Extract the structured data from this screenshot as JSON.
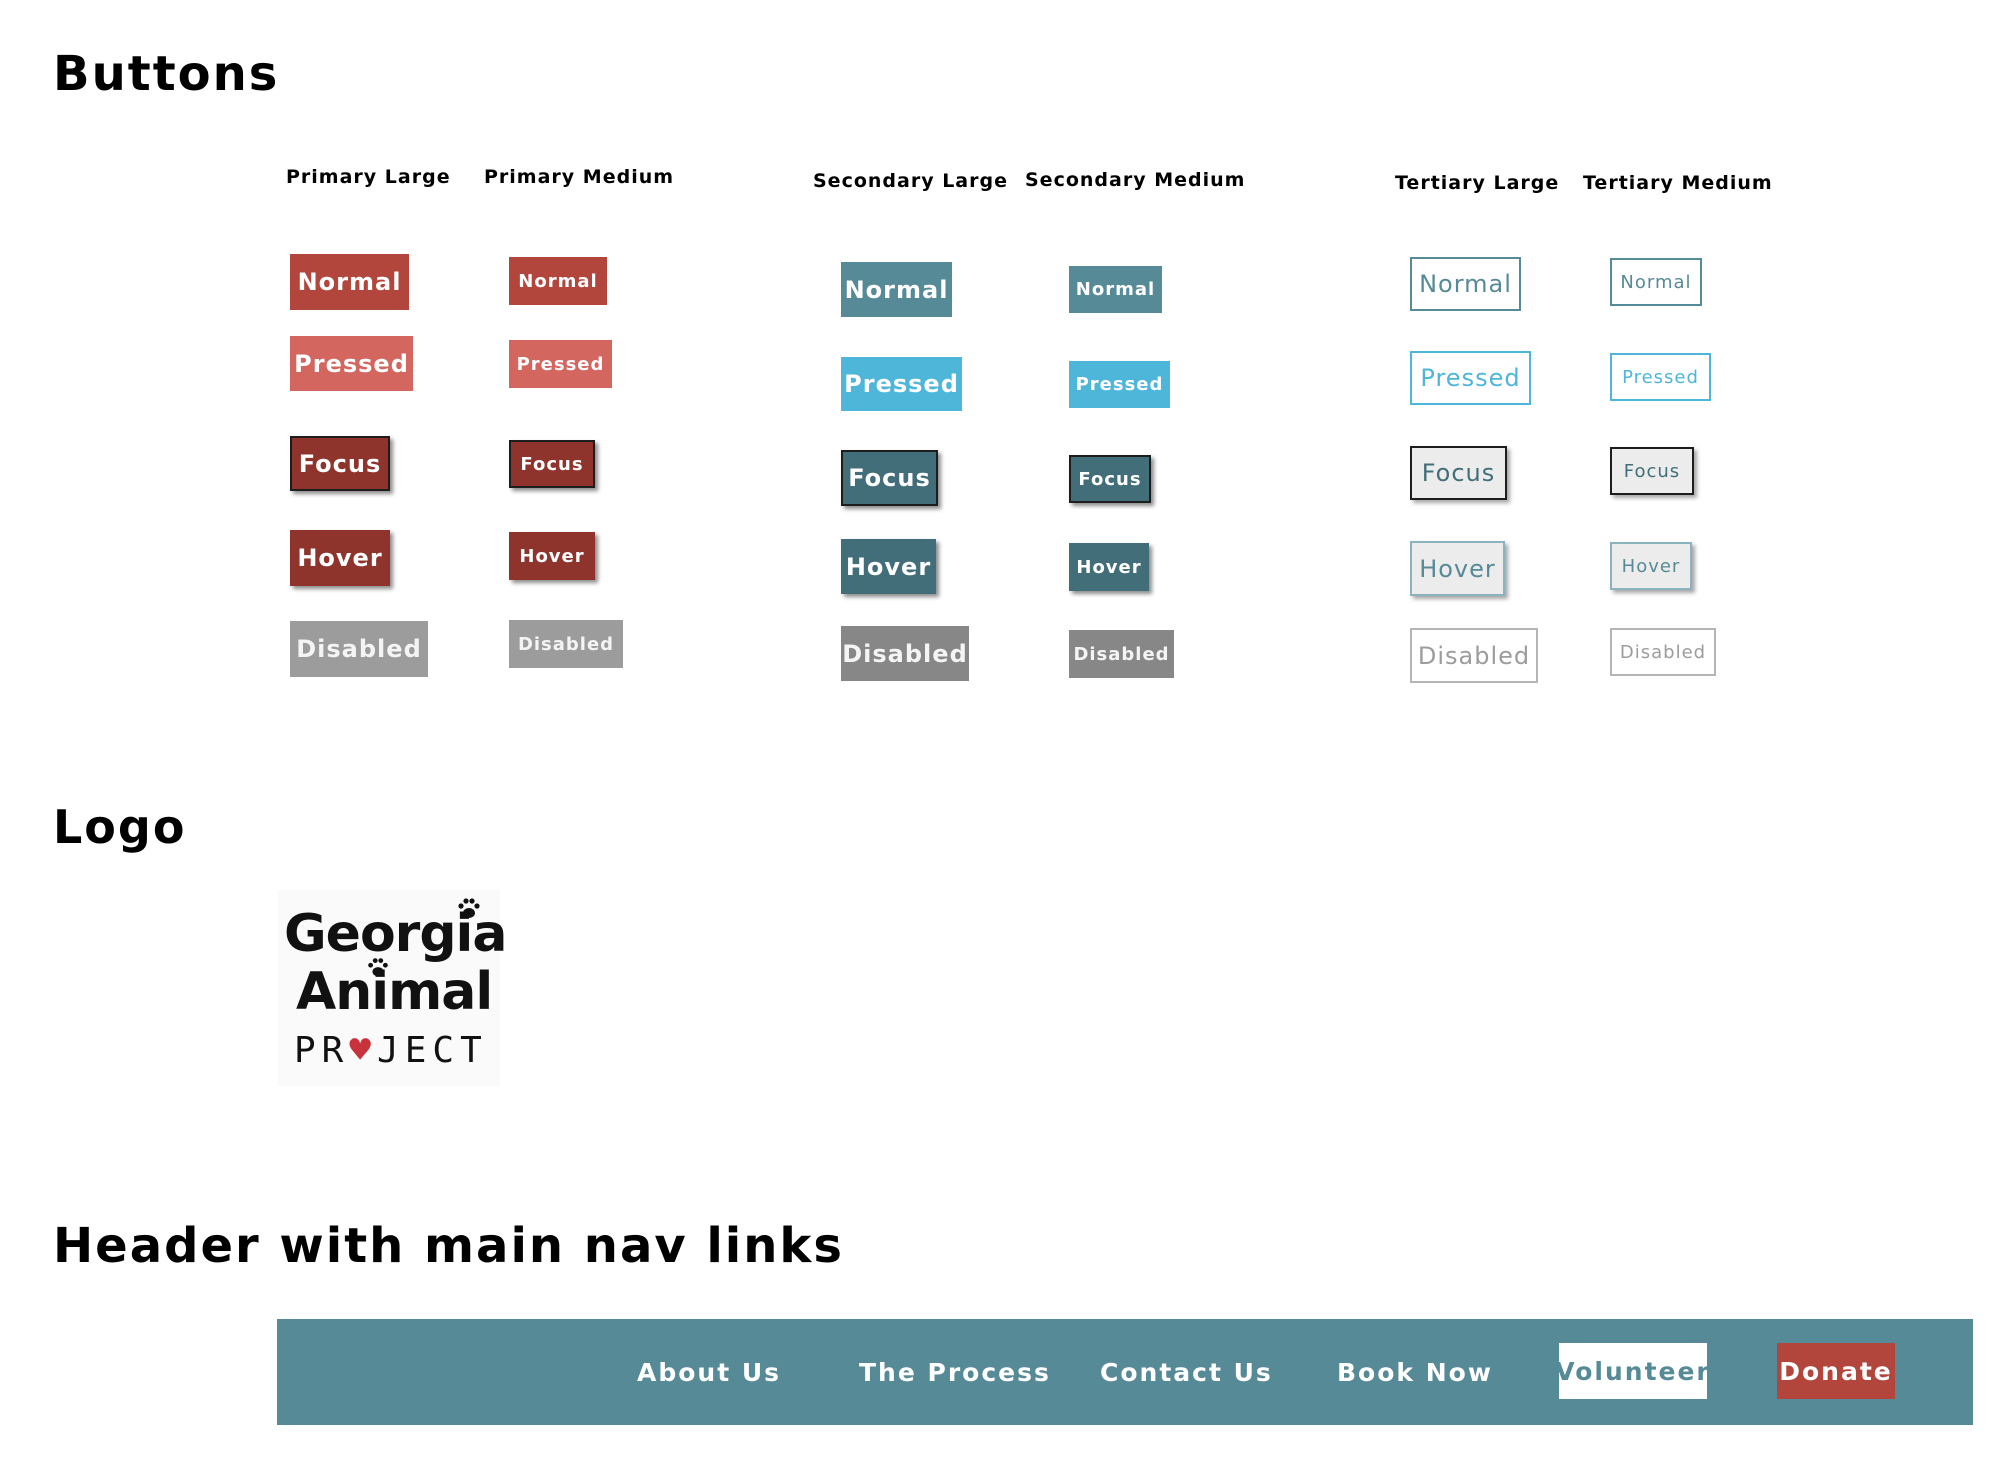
{
  "sections": {
    "buttons_title": "Buttons",
    "logo_title": "Logo",
    "header_title": "Header with main nav links"
  },
  "button_groups": {
    "primary_large": "Primary Large",
    "primary_medium": "Primary Medium",
    "secondary_large": "Secondary Large",
    "secondary_medium": "Secondary Medium",
    "tertiary_large": "Tertiary Large",
    "tertiary_medium": "Tertiary Medium"
  },
  "states": {
    "normal": "Normal",
    "pressed": "Pressed",
    "focus": "Focus",
    "hover": "Hover",
    "disabled": "Disabled"
  },
  "logo": {
    "line1": "Georgia",
    "line2": "Animal",
    "line3": "PROJECT",
    "icons": [
      "paw-print",
      "paw-print",
      "heart"
    ]
  },
  "nav": {
    "links": [
      "About Us",
      "The Process",
      "Contact Us",
      "Book Now"
    ],
    "volunteer": "Volunteer",
    "donate": "Donate"
  },
  "colors": {
    "primary": "#b2463d",
    "primary_pressed": "#d3665f",
    "primary_dark": "#8f342c",
    "secondary": "#578a97",
    "secondary_pressed": "#4eb6d8",
    "secondary_dark": "#426e79",
    "disabled": "#9c9c9c",
    "logo_heart": "#c8323a"
  }
}
